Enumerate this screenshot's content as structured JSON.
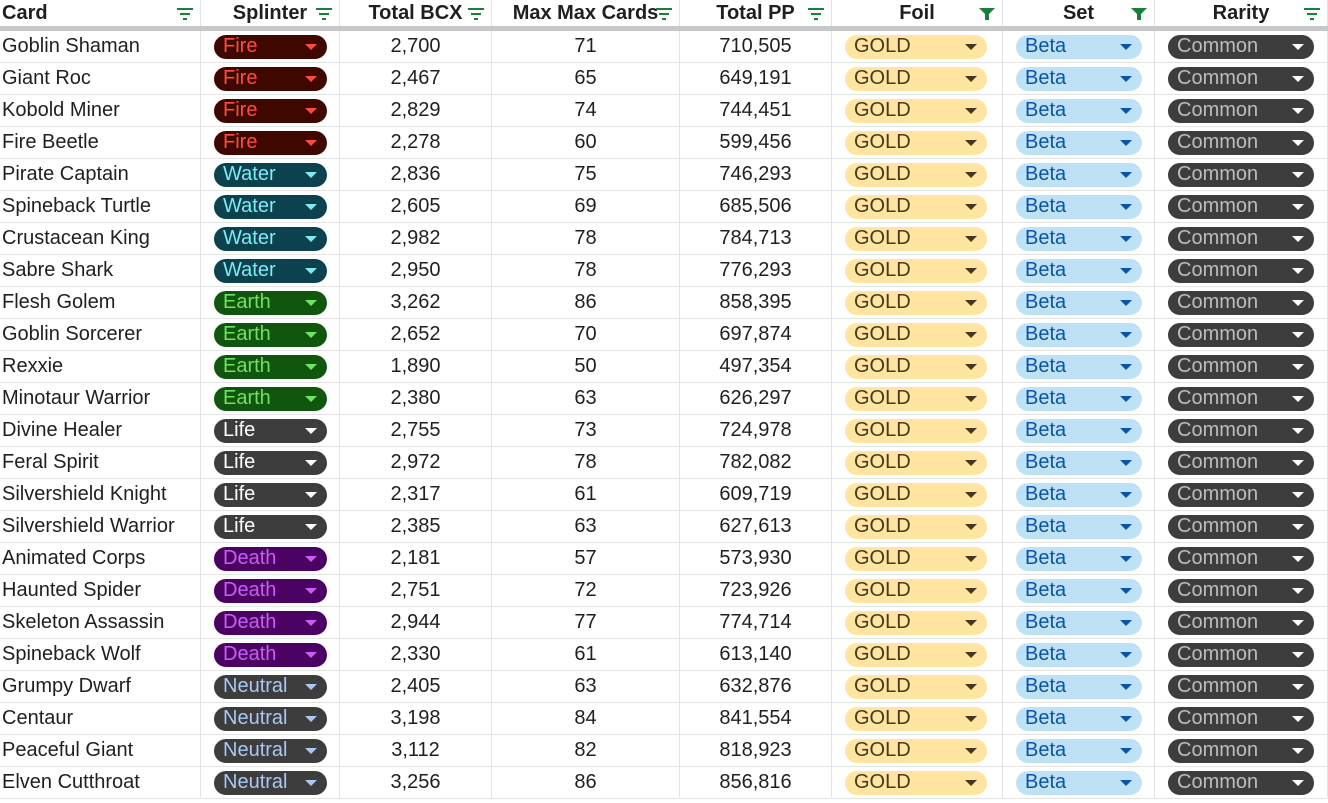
{
  "headers": [
    {
      "label": "Card",
      "filter": "filter-icon"
    },
    {
      "label": "Splinter",
      "filter": "filter-icon"
    },
    {
      "label": "Total BCX",
      "filter": "filter-icon"
    },
    {
      "label": "Max Max Cards",
      "filter": "filter-icon"
    },
    {
      "label": "Total PP",
      "filter": "filter-icon"
    },
    {
      "label": "Foil",
      "filter": "filter-active-icon"
    },
    {
      "label": "Set",
      "filter": "filter-active-icon"
    },
    {
      "label": "Rarity",
      "filter": "filter-icon"
    }
  ],
  "colors": {
    "Fire": {
      "bg": "#3e0800",
      "fg": "#ff4b3b"
    },
    "Water": {
      "bg": "#0b424e",
      "fg": "#7fe9f6"
    },
    "Earth": {
      "bg": "#11560f",
      "fg": "#73df63"
    },
    "Life": {
      "bg": "#3d3d3d",
      "fg": "#ffffff"
    },
    "Death": {
      "bg": "#4a0363",
      "fg": "#cd5cf4"
    },
    "Neutral": {
      "bg": "#3d3d3d",
      "fg": "#a9c8f2"
    },
    "filter": "#188038"
  },
  "rows": [
    {
      "card": "Goblin Shaman",
      "splinter": "Fire",
      "bcx": "2,700",
      "max": "71",
      "pp": "710,505",
      "foil": "GOLD",
      "set": "Beta",
      "rarity": "Common"
    },
    {
      "card": "Giant Roc",
      "splinter": "Fire",
      "bcx": "2,467",
      "max": "65",
      "pp": "649,191",
      "foil": "GOLD",
      "set": "Beta",
      "rarity": "Common"
    },
    {
      "card": "Kobold Miner",
      "splinter": "Fire",
      "bcx": "2,829",
      "max": "74",
      "pp": "744,451",
      "foil": "GOLD",
      "set": "Beta",
      "rarity": "Common"
    },
    {
      "card": "Fire Beetle",
      "splinter": "Fire",
      "bcx": "2,278",
      "max": "60",
      "pp": "599,456",
      "foil": "GOLD",
      "set": "Beta",
      "rarity": "Common"
    },
    {
      "card": "Pirate Captain",
      "splinter": "Water",
      "bcx": "2,836",
      "max": "75",
      "pp": "746,293",
      "foil": "GOLD",
      "set": "Beta",
      "rarity": "Common"
    },
    {
      "card": "Spineback Turtle",
      "splinter": "Water",
      "bcx": "2,605",
      "max": "69",
      "pp": "685,506",
      "foil": "GOLD",
      "set": "Beta",
      "rarity": "Common"
    },
    {
      "card": "Crustacean King",
      "splinter": "Water",
      "bcx": "2,982",
      "max": "78",
      "pp": "784,713",
      "foil": "GOLD",
      "set": "Beta",
      "rarity": "Common"
    },
    {
      "card": "Sabre Shark",
      "splinter": "Water",
      "bcx": "2,950",
      "max": "78",
      "pp": "776,293",
      "foil": "GOLD",
      "set": "Beta",
      "rarity": "Common"
    },
    {
      "card": "Flesh Golem",
      "splinter": "Earth",
      "bcx": "3,262",
      "max": "86",
      "pp": "858,395",
      "foil": "GOLD",
      "set": "Beta",
      "rarity": "Common"
    },
    {
      "card": "Goblin Sorcerer",
      "splinter": "Earth",
      "bcx": "2,652",
      "max": "70",
      "pp": "697,874",
      "foil": "GOLD",
      "set": "Beta",
      "rarity": "Common"
    },
    {
      "card": "Rexxie",
      "splinter": "Earth",
      "bcx": "1,890",
      "max": "50",
      "pp": "497,354",
      "foil": "GOLD",
      "set": "Beta",
      "rarity": "Common"
    },
    {
      "card": "Minotaur Warrior",
      "splinter": "Earth",
      "bcx": "2,380",
      "max": "63",
      "pp": "626,297",
      "foil": "GOLD",
      "set": "Beta",
      "rarity": "Common"
    },
    {
      "card": "Divine Healer",
      "splinter": "Life",
      "bcx": "2,755",
      "max": "73",
      "pp": "724,978",
      "foil": "GOLD",
      "set": "Beta",
      "rarity": "Common"
    },
    {
      "card": "Feral Spirit",
      "splinter": "Life",
      "bcx": "2,972",
      "max": "78",
      "pp": "782,082",
      "foil": "GOLD",
      "set": "Beta",
      "rarity": "Common"
    },
    {
      "card": "Silvershield Knight",
      "splinter": "Life",
      "bcx": "2,317",
      "max": "61",
      "pp": "609,719",
      "foil": "GOLD",
      "set": "Beta",
      "rarity": "Common"
    },
    {
      "card": "Silvershield Warrior",
      "splinter": "Life",
      "bcx": "2,385",
      "max": "63",
      "pp": "627,613",
      "foil": "GOLD",
      "set": "Beta",
      "rarity": "Common"
    },
    {
      "card": "Animated Corps",
      "splinter": "Death",
      "bcx": "2,181",
      "max": "57",
      "pp": "573,930",
      "foil": "GOLD",
      "set": "Beta",
      "rarity": "Common"
    },
    {
      "card": "Haunted Spider",
      "splinter": "Death",
      "bcx": "2,751",
      "max": "72",
      "pp": "723,926",
      "foil": "GOLD",
      "set": "Beta",
      "rarity": "Common"
    },
    {
      "card": "Skeleton Assassin",
      "splinter": "Death",
      "bcx": "2,944",
      "max": "77",
      "pp": "774,714",
      "foil": "GOLD",
      "set": "Beta",
      "rarity": "Common"
    },
    {
      "card": "Spineback Wolf",
      "splinter": "Death",
      "bcx": "2,330",
      "max": "61",
      "pp": "613,140",
      "foil": "GOLD",
      "set": "Beta",
      "rarity": "Common"
    },
    {
      "card": "Grumpy Dwarf",
      "splinter": "Neutral",
      "bcx": "2,405",
      "max": "63",
      "pp": "632,876",
      "foil": "GOLD",
      "set": "Beta",
      "rarity": "Common"
    },
    {
      "card": "Centaur",
      "splinter": "Neutral",
      "bcx": "3,198",
      "max": "84",
      "pp": "841,554",
      "foil": "GOLD",
      "set": "Beta",
      "rarity": "Common"
    },
    {
      "card": "Peaceful Giant",
      "splinter": "Neutral",
      "bcx": "3,112",
      "max": "82",
      "pp": "818,923",
      "foil": "GOLD",
      "set": "Beta",
      "rarity": "Common"
    },
    {
      "card": "Elven Cutthroat",
      "splinter": "Neutral",
      "bcx": "3,256",
      "max": "86",
      "pp": "856,816",
      "foil": "GOLD",
      "set": "Beta",
      "rarity": "Common"
    }
  ]
}
